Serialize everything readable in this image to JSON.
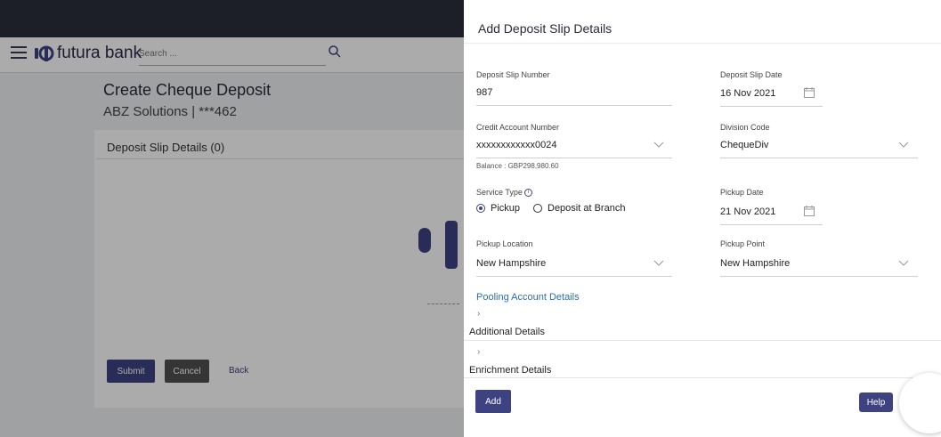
{
  "app": {
    "brand": "futura bank",
    "search_placeholder": "Search ..."
  },
  "page": {
    "title": "Create Cheque Deposit",
    "subtitle": "ABZ Solutions | ***462",
    "card_heading": "Deposit Slip Details (0)",
    "submit_label": "Submit",
    "cancel_label": "Cancel",
    "back_label": "Back"
  },
  "panel": {
    "title": "Add Deposit Slip Details",
    "deposit_slip_number": {
      "label": "Deposit Slip Number",
      "value": "987"
    },
    "deposit_slip_date": {
      "label": "Deposit Slip Date",
      "value": "16 Nov 2021"
    },
    "credit_account_number": {
      "label": "Credit Account Number",
      "value": "xxxxxxxxxxxx0024",
      "balance": "Balance : GBP298,980.60"
    },
    "division_code": {
      "label": "Division Code",
      "value": "ChequeDiv"
    },
    "service_type": {
      "label": "Service Type",
      "options": [
        "Pickup",
        "Deposit at Branch"
      ],
      "selected": "Pickup"
    },
    "pickup_date": {
      "label": "Pickup Date",
      "value": "21 Nov 2021"
    },
    "pickup_location": {
      "label": "Pickup Location",
      "value": "New Hampshire"
    },
    "pickup_point": {
      "label": "Pickup Point",
      "value": "New Hampshire"
    },
    "pooling_link": "Pooling Account Details",
    "sections": [
      "Additional Details",
      "Enrichment Details"
    ],
    "add_label": "Add",
    "help_label": "Help"
  },
  "colors": {
    "primary": "#3e4280",
    "topbar": "#2c2f3c",
    "link": "#2a6fb0"
  }
}
